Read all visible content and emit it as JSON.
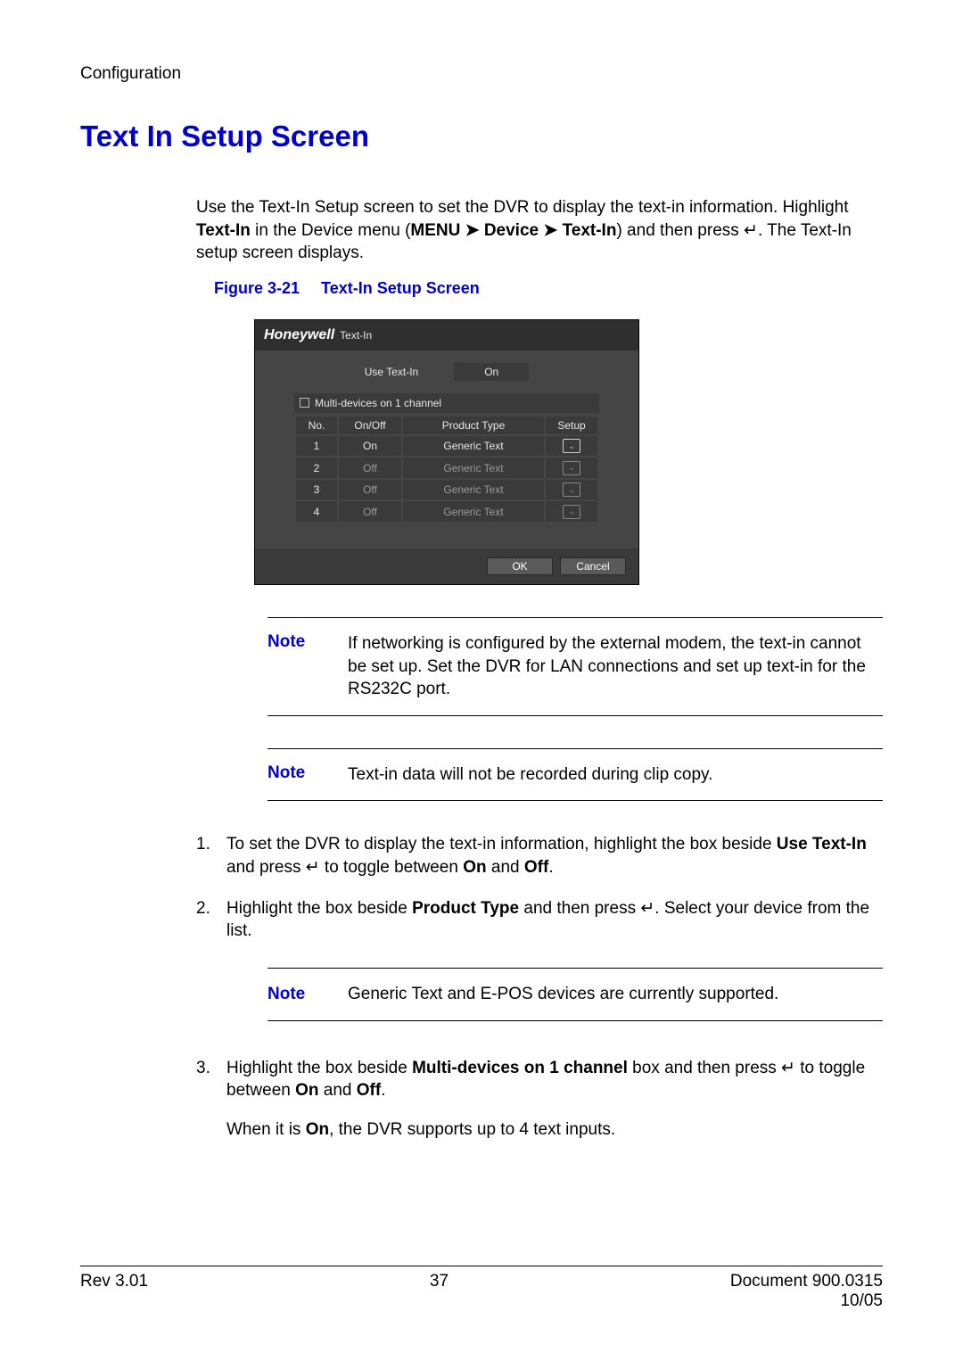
{
  "header": {
    "section": "Configuration"
  },
  "title": "Text In Setup Screen",
  "intro": {
    "p1a": "Use the Text-In Setup screen to set the DVR to display the text-in information. Highlight ",
    "p1b_bold": "Text-In",
    "p1c": " in the Device menu (",
    "menu_bold": "MENU  ➤  Device  ➤  Text-In",
    "p1d": ") and then press ",
    "enter1": "↵",
    "p1e": ". The Text-In setup screen displays."
  },
  "figure": {
    "label": "Figure 3-21",
    "title": "Text-In Setup Screen"
  },
  "screenshot": {
    "brand": "Honeywell",
    "win_title": "Text-In",
    "use_label": "Use Text-In",
    "use_value": "On",
    "multi_label": "Multi-devices on 1 channel",
    "headers": {
      "no": "No.",
      "onoff": "On/Off",
      "ptype": "Product Type",
      "setup": "Setup"
    },
    "rows": [
      {
        "no": "1",
        "onoff": "On",
        "ptype": "Generic Text",
        "active": true
      },
      {
        "no": "2",
        "onoff": "Off",
        "ptype": "Generic Text",
        "active": false
      },
      {
        "no": "3",
        "onoff": "Off",
        "ptype": "Generic Text",
        "active": false
      },
      {
        "no": "4",
        "onoff": "Off",
        "ptype": "Generic Text",
        "active": false
      }
    ],
    "ok": "OK",
    "cancel": "Cancel"
  },
  "notes": {
    "label": "Note",
    "n1": "If networking is configured by the external modem, the text-in cannot be set up. Set the DVR for LAN connections and set up text-in for the RS232C port.",
    "n2": "Text-in data will not be recorded during clip copy.",
    "n3": "Generic Text and E-POS devices are currently supported."
  },
  "steps": {
    "s1a": "To set the DVR to display the text-in information, highlight the box beside ",
    "s1b_bold": "Use Text-In",
    "s1c": " and press ",
    "enter2": "↵",
    "s1d": " to toggle between ",
    "on": "On",
    "s1e": " and ",
    "off": "Off",
    "s1f": ".",
    "s2a": "Highlight the box beside ",
    "s2b_bold": "Product Type",
    "s2c": " and then press ",
    "enter3": "↵",
    "s2d": ". Select your device from the list.",
    "s3a": "Highlight the box beside ",
    "s3b_bold": "Multi-devices on 1 channel",
    "s3c": " box and then press ",
    "enter4": "↵",
    "s3d": " to toggle between ",
    "s3e": ".",
    "s3_after_a": "When it is ",
    "s3_after_b": ", the DVR supports up to 4 text inputs."
  },
  "footer": {
    "rev": "Rev 3.01",
    "page": "37",
    "doc": "Document 900.0315",
    "date": "10/05"
  }
}
